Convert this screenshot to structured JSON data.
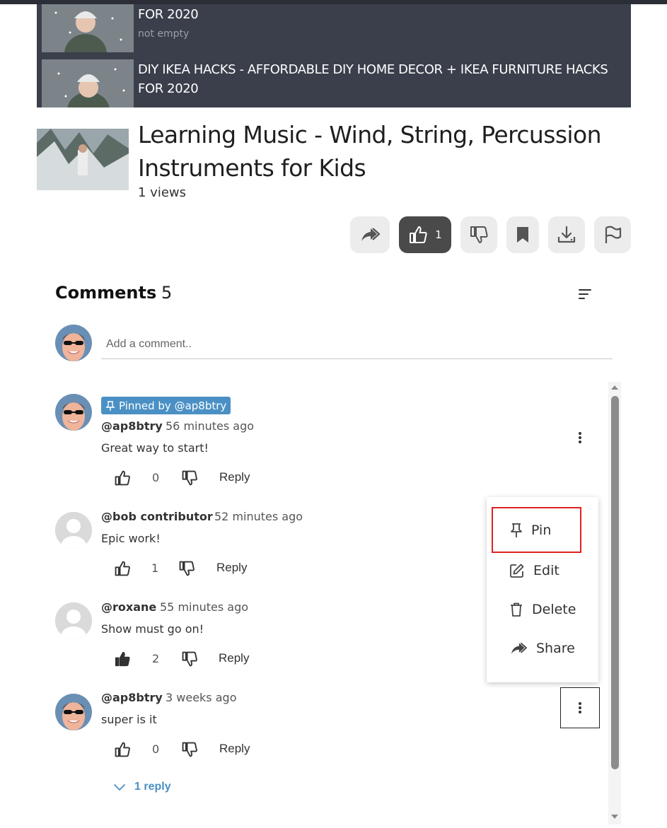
{
  "playlist": {
    "items": [
      {
        "title": "FOR 2020",
        "subtitle": "not empty"
      },
      {
        "title": "DIY IKEA HACKS - AFFORDABLE DIY HOME DECOR + IKEA FURNITURE HACKS FOR 2020"
      }
    ]
  },
  "video": {
    "title": "Learning Music - Wind, String, Percussion Instruments for Kids",
    "views": "1 views",
    "like_count": "1"
  },
  "comments": {
    "title": "Comments",
    "count": "5",
    "add_placeholder": "Add a comment..",
    "pinned_label": "Pinned by @ap8btry",
    "reply_label": "Reply",
    "replies_label": "1 reply",
    "items": [
      {
        "author": "@ap8btry",
        "time": "56 minutes ago",
        "text": "Great way to start!",
        "likes": "0"
      },
      {
        "author": "@bob contributor",
        "time": "52 minutes ago",
        "text": "Epic work!",
        "likes": "1"
      },
      {
        "author": "@roxane",
        "time": "55 minutes ago",
        "text": "Show must go on!",
        "likes": "2"
      },
      {
        "author": "@ap8btry",
        "time": "3 weeks ago",
        "text": "super is it",
        "likes": "0"
      }
    ]
  },
  "menu": {
    "pin": "Pin",
    "edit": "Edit",
    "delete": "Delete",
    "share": "Share"
  },
  "colors": {
    "playlist_bg": "#3a3f4b",
    "accent_blue": "#4a90c4",
    "active_button": "#4a4a4a",
    "highlight_red": "#e02020"
  }
}
